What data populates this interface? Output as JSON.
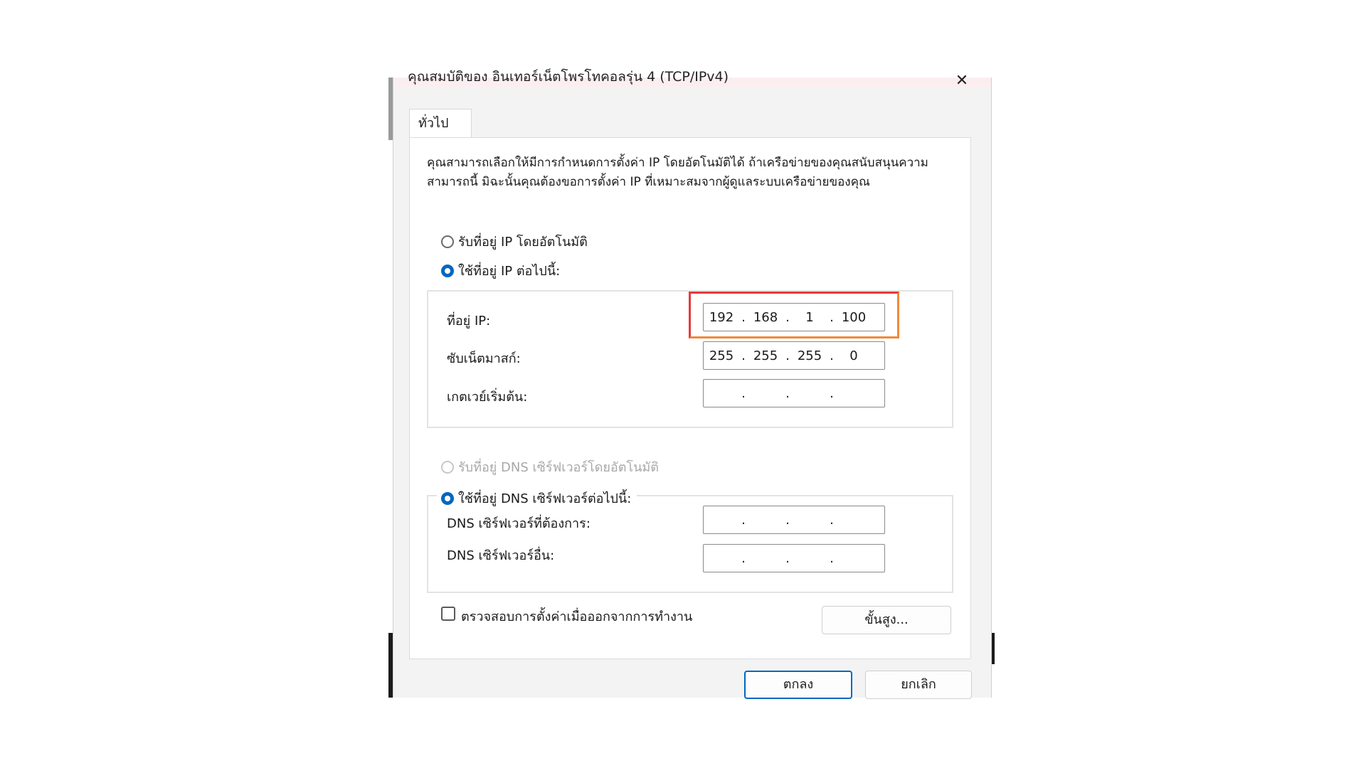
{
  "dialog": {
    "title": "คุณสมบัติของ อินเทอร์เน็ตโพรโทคอลรุ่น 4 (TCP/IPv4)",
    "close_icon": "close-icon"
  },
  "tab": {
    "label": "ทั่วไป"
  },
  "description": "คุณสามารถเลือกให้มีการกำหนดการตั้งค่า IP โดยอัตโนมัติได้ ถ้าเครือข่ายของคุณสนับสนุนความสามารถนี้ มิฉะนั้นคุณต้องขอการตั้งค่า IP ที่เหมาะสมจากผู้ดูแลระบบเครือข่ายของคุณ",
  "ip_section": {
    "auto_label": "รับที่อยู่ IP โดยอัตโนมัติ",
    "manual_label": "ใช้ที่อยู่ IP ต่อไปนี้:",
    "selected": "manual",
    "ip_label": "ที่อยู่ IP:",
    "ip_value": [
      "192",
      "168",
      "1",
      "100"
    ],
    "subnet_label": "ซับเน็ตมาสก์:",
    "subnet_value": [
      "255",
      "255",
      "255",
      "0"
    ],
    "gateway_label": "เกตเวย์เริ่มต้น:",
    "gateway_value": [
      "",
      "",
      "",
      ""
    ]
  },
  "dns_section": {
    "auto_label": "รับที่อยู่ DNS เซิร์ฟเวอร์โดยอัตโนมัติ",
    "manual_label": "ใช้ที่อยู่ DNS เซิร์ฟเวอร์ต่อไปนี้:",
    "selected": "manual",
    "preferred_label": "DNS เซิร์ฟเวอร์ที่ต้องการ:",
    "preferred_value": [
      "",
      "",
      "",
      ""
    ],
    "alternate_label": "DNS เซิร์ฟเวอร์อื่น:",
    "alternate_value": [
      "",
      "",
      "",
      ""
    ]
  },
  "validate_label": "ตรวจสอบการตั้งค่าเมื่อออกจากการทำงาน",
  "validate_checked": false,
  "buttons": {
    "advanced": "ขั้นสูง...",
    "ok": "ตกลง",
    "cancel": "ยกเลิก"
  },
  "colors": {
    "accent": "#0067c0",
    "highlight_box": "#e83a3a"
  }
}
